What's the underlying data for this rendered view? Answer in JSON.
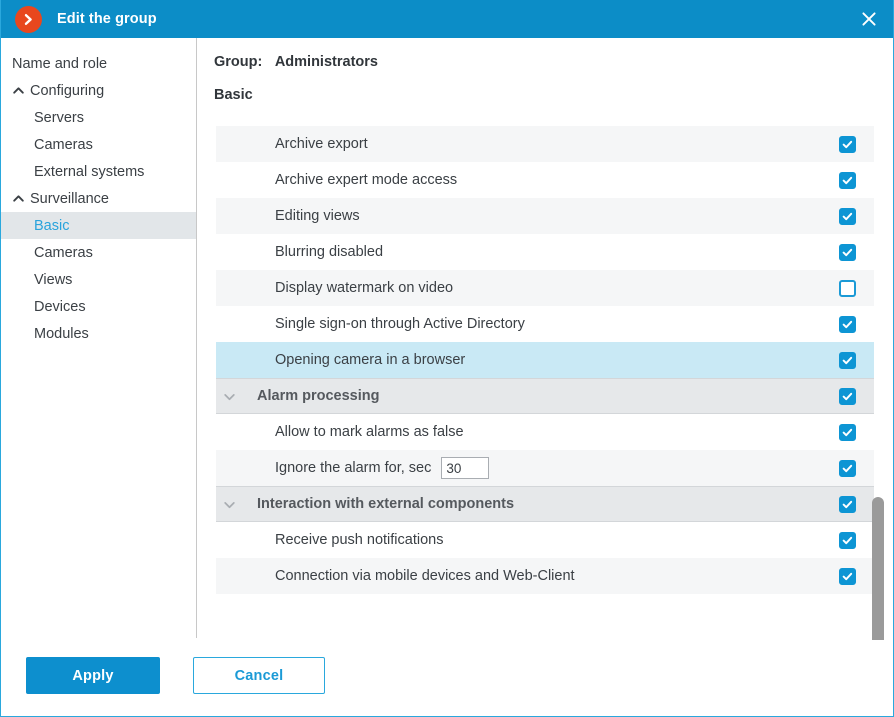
{
  "window": {
    "title": "Edit the group",
    "app_icon": "chevron-right-circle-icon",
    "close_icon": "close-icon",
    "accent_color": "#0c8dc7",
    "icon_color": "#e8471e"
  },
  "sidebar": {
    "items": [
      {
        "label": "Name and role",
        "level": "root",
        "chevron": null,
        "selected": false
      },
      {
        "label": "Configuring",
        "level": "group",
        "chevron": "chevron-up-icon",
        "selected": false
      },
      {
        "label": "Servers",
        "level": "child",
        "chevron": null,
        "selected": false
      },
      {
        "label": "Cameras",
        "level": "child",
        "chevron": null,
        "selected": false
      },
      {
        "label": "External systems",
        "level": "child",
        "chevron": null,
        "selected": false
      },
      {
        "label": "Surveillance",
        "level": "group",
        "chevron": "chevron-up-icon",
        "selected": false
      },
      {
        "label": "Basic",
        "level": "child",
        "chevron": null,
        "selected": true
      },
      {
        "label": "Cameras",
        "level": "child",
        "chevron": null,
        "selected": false
      },
      {
        "label": "Views",
        "level": "child",
        "chevron": null,
        "selected": false
      },
      {
        "label": "Devices",
        "level": "child",
        "chevron": null,
        "selected": false
      },
      {
        "label": "Modules",
        "level": "child",
        "chevron": null,
        "selected": false
      }
    ]
  },
  "content": {
    "group_label": "Group:",
    "group_name": "Administrators",
    "section_title": "Basic",
    "rows": [
      {
        "label": "Archive export",
        "type": "item",
        "style": "stripe",
        "checked": true
      },
      {
        "label": "Archive expert mode access",
        "type": "item",
        "style": "plain",
        "checked": true
      },
      {
        "label": "Editing views",
        "type": "item",
        "style": "stripe",
        "checked": true
      },
      {
        "label": "Blurring disabled",
        "type": "item",
        "style": "plain",
        "checked": true
      },
      {
        "label": "Display watermark on video",
        "type": "item",
        "style": "stripe",
        "checked": false
      },
      {
        "label": "Single sign-on through Active Directory",
        "type": "item",
        "style": "plain",
        "checked": true
      },
      {
        "label": "Opening camera in a browser",
        "type": "item",
        "style": "highlight",
        "checked": true
      },
      {
        "label": "Alarm processing",
        "type": "header",
        "style": "header",
        "checked": true,
        "chevron": "chevron-down-icon"
      },
      {
        "label": "Allow to mark alarms as false",
        "type": "item",
        "style": "plain",
        "checked": true
      },
      {
        "label": "Ignore the alarm for, sec",
        "type": "input",
        "style": "stripe",
        "checked": true,
        "value": "30"
      },
      {
        "label": "Interaction with external components",
        "type": "header",
        "style": "header",
        "checked": true,
        "chevron": "chevron-down-icon"
      },
      {
        "label": "Receive push notifications",
        "type": "item",
        "style": "plain",
        "checked": true
      },
      {
        "label": "Connection via mobile devices and Web-Client",
        "type": "item",
        "style": "stripe",
        "checked": true
      }
    ]
  },
  "scrollbar": {
    "name": "vertical-scrollbar",
    "thumb_top_pct": 70.7,
    "thumb_height_pct": 29.3
  },
  "footer": {
    "apply_label": "Apply",
    "cancel_label": "Cancel"
  }
}
